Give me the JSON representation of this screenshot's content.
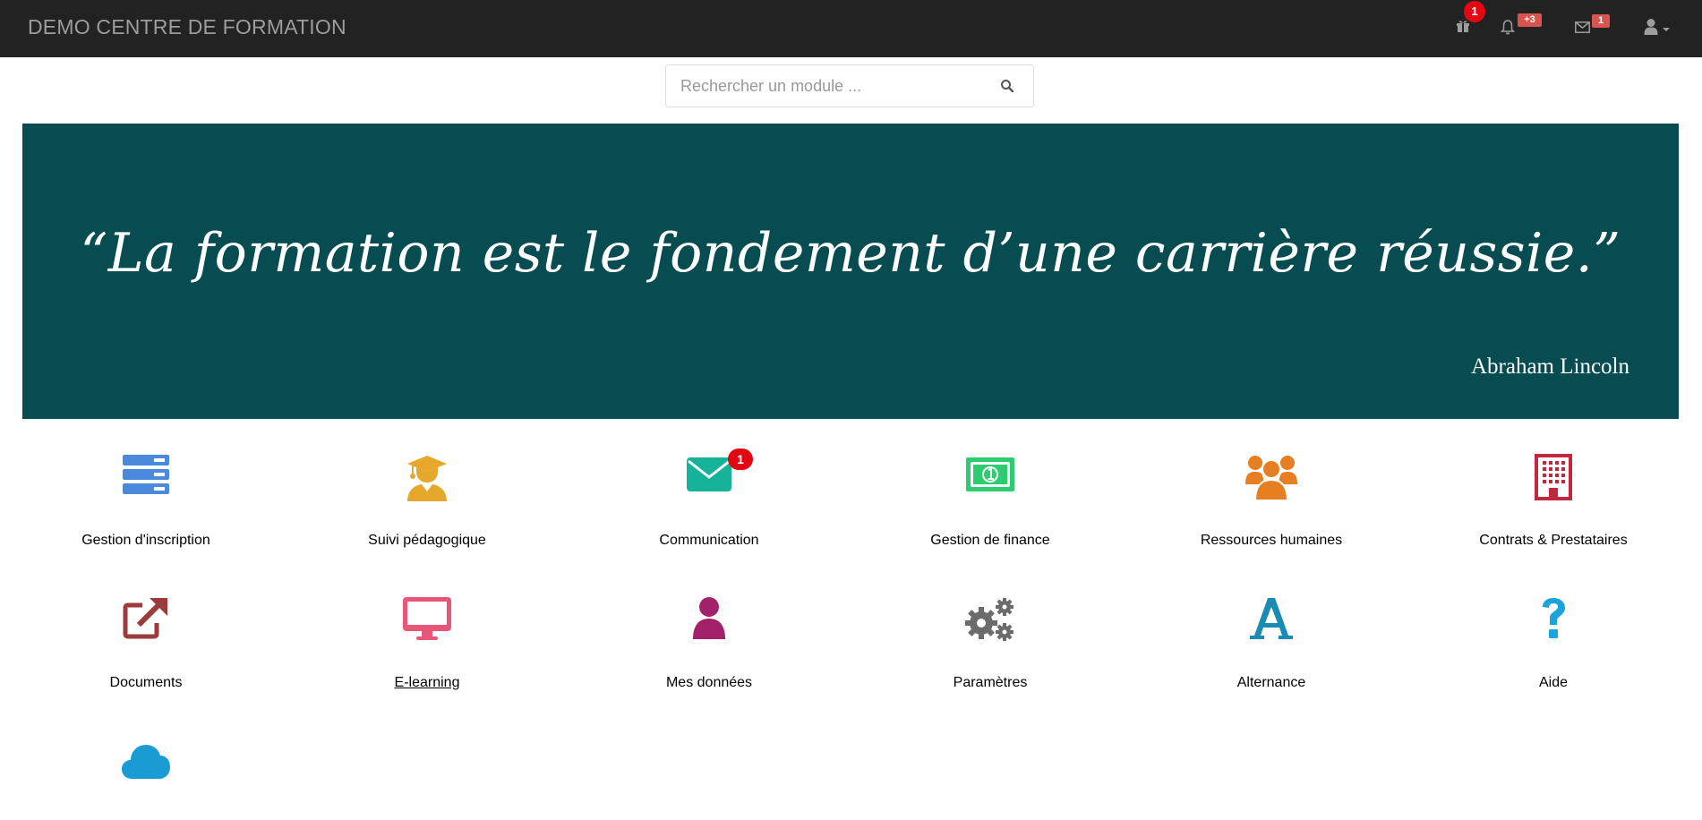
{
  "navbar": {
    "brand": "DEMO CENTRE DE FORMATION",
    "gift_badge": "1",
    "bell_badge": "+3",
    "mail_badge": "1"
  },
  "search": {
    "placeholder": "Rechercher un module ..."
  },
  "banner": {
    "quote": "“La formation est le fondement d’une carrière réussie.”",
    "author": "Abraham Lincoln",
    "background": "#064c50"
  },
  "modules": [
    {
      "label": "Gestion d'inscription",
      "icon": "server-stack-icon",
      "color": "#4a89dc"
    },
    {
      "label": "Suivi pédagogique",
      "icon": "graduate-icon",
      "color": "#e5a82a"
    },
    {
      "label": "Communication",
      "icon": "envelope-icon",
      "color": "#16b39a",
      "badge": "1"
    },
    {
      "label": "Gestion de finance",
      "icon": "money-icon",
      "color": "#2ecc71"
    },
    {
      "label": "Ressources humaines",
      "icon": "users-icon",
      "color": "#e67e22"
    },
    {
      "label": "Contrats & Prestataires",
      "icon": "building-icon",
      "color": "#c0283f"
    },
    {
      "label": "Documents",
      "icon": "external-link-icon",
      "color": "#9b3b3b"
    },
    {
      "label": "E-learning",
      "icon": "desktop-icon",
      "color": "#e8577a"
    },
    {
      "label": "Mes données",
      "icon": "user-icon",
      "color": "#a3206b"
    },
    {
      "label": "Paramètres",
      "icon": "gears-icon",
      "color": "#6b6b6b"
    },
    {
      "label": "Alternance",
      "icon": "font-a-icon",
      "color": "#1a8bb3"
    },
    {
      "label": "Aide",
      "icon": "question-icon",
      "color": "#1aa3dd"
    },
    {
      "label": "",
      "icon": "cloud-icon",
      "color": "#1a9bd4"
    }
  ]
}
